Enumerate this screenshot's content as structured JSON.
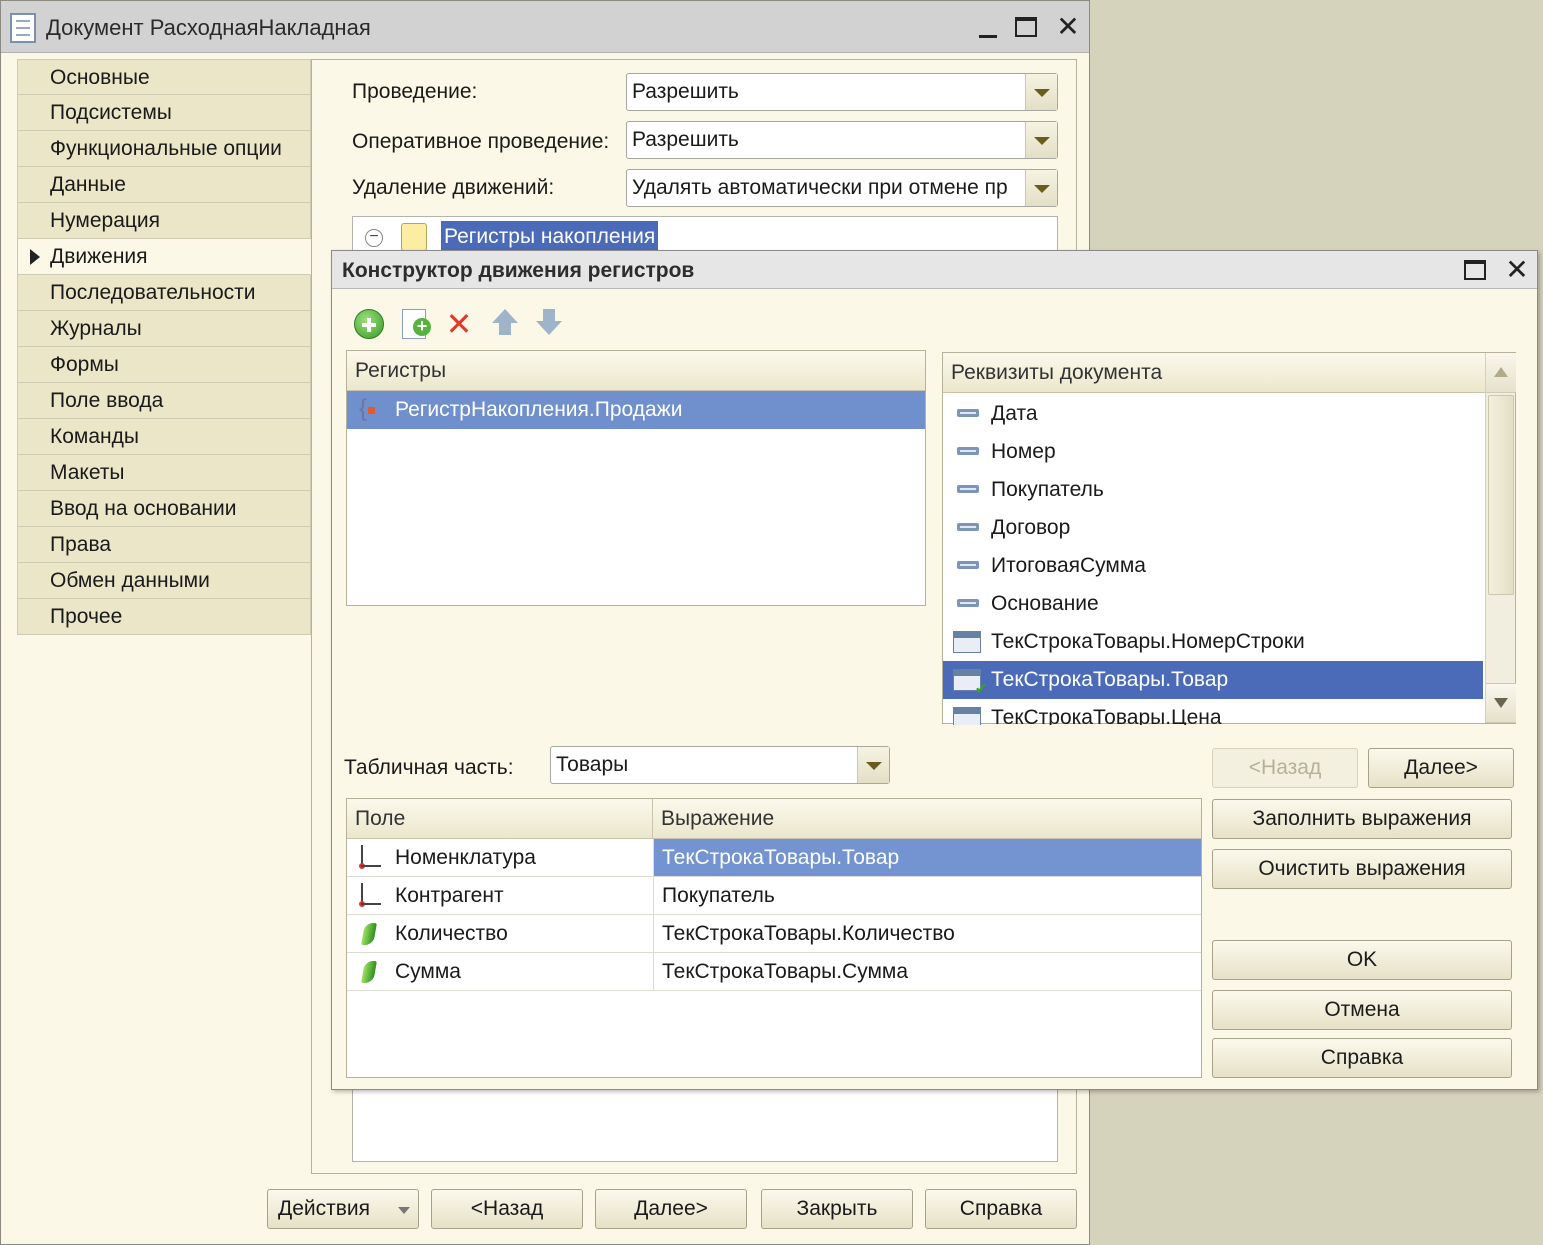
{
  "main_window": {
    "title": "Документ РасходнаяНакладная",
    "tabs": [
      {
        "label": "Основные"
      },
      {
        "label": "Подсистемы"
      },
      {
        "label": "Функциональные опции"
      },
      {
        "label": "Данные"
      },
      {
        "label": "Нумерация"
      },
      {
        "label": "Движения",
        "active": true
      },
      {
        "label": "Последовательности"
      },
      {
        "label": "Журналы"
      },
      {
        "label": "Формы"
      },
      {
        "label": "Поле ввода"
      },
      {
        "label": "Команды"
      },
      {
        "label": "Макеты"
      },
      {
        "label": "Ввод на основании"
      },
      {
        "label": "Права"
      },
      {
        "label": "Обмен данными"
      },
      {
        "label": "Прочее"
      }
    ],
    "posting_label": "Проведение:",
    "posting_value": "Разрешить",
    "realtime_label": "Оперативное проведение:",
    "realtime_value": "Разрешить",
    "delete_label": "Удаление движений:",
    "delete_value": "Удалять автоматически при отмене пр",
    "tree_node": "Регистры накопления",
    "footer": {
      "actions": "Действия",
      "back": "<Назад",
      "next": "Далее>",
      "close": "Закрыть",
      "help": "Справка"
    }
  },
  "dialog": {
    "title": "Конструктор движения регистров",
    "registers_header": "Регистры",
    "registers": [
      "РегистрНакопления.Продажи"
    ],
    "attributes_header": "Реквизиты документа",
    "attributes": [
      {
        "name": "Дата",
        "icon": "field-icon"
      },
      {
        "name": "Номер",
        "icon": "field-icon"
      },
      {
        "name": "Покупатель",
        "icon": "field-icon"
      },
      {
        "name": "Договор",
        "icon": "field-icon"
      },
      {
        "name": "ИтоговаяСумма",
        "icon": "field-icon"
      },
      {
        "name": "Основание",
        "icon": "field-icon"
      },
      {
        "name": "ТекСтрокаТовары.НомерСтроки",
        "icon": "tabular-field-icon"
      },
      {
        "name": "ТекСтрокаТовары.Товар",
        "icon": "tabular-field-check-icon",
        "selected": true
      },
      {
        "name": "ТекСтрокаТовары.Цена",
        "icon": "tabular-field-icon"
      }
    ],
    "tabular_label": "Табличная часть:",
    "tabular_value": "Товары",
    "buttons": {
      "back": "<Назад",
      "next": "Далее>",
      "fill": "Заполнить выражения",
      "clear": "Очистить выражения",
      "ok": "OK",
      "cancel": "Отмена",
      "help": "Справка"
    },
    "grid": {
      "columns": [
        "Поле",
        "Выражение"
      ],
      "rows": [
        {
          "field": "Номенклатура",
          "expression": "ТекСтрокаТовары.Товар",
          "kind": "dimension",
          "selected": true
        },
        {
          "field": "Контрагент",
          "expression": "Покупатель",
          "kind": "dimension"
        },
        {
          "field": "Количество",
          "expression": "ТекСтрокаТовары.Количество",
          "kind": "resource"
        },
        {
          "field": "Сумма",
          "expression": "ТекСтрокаТовары.Сумма",
          "kind": "resource"
        }
      ]
    }
  }
}
